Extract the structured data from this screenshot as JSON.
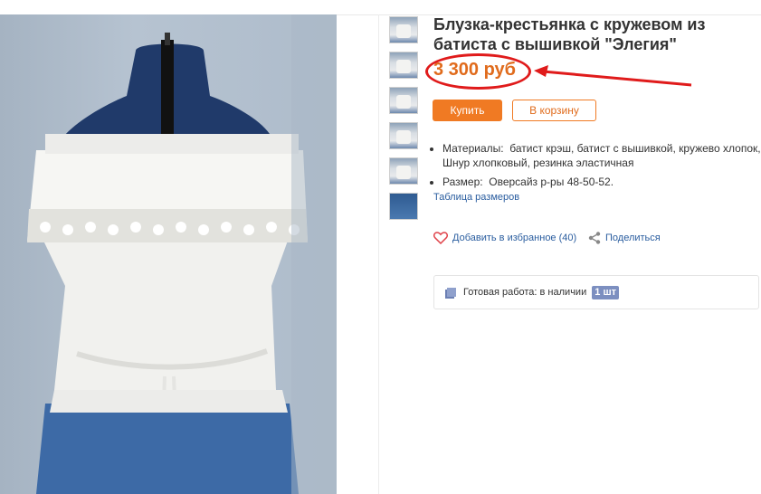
{
  "product": {
    "title": "Блузка-крестьянка с кружевом из батиста с вышивкой \"Элегия\"",
    "price": "3 300 руб",
    "buy_label": "Купить",
    "cart_label": "В корзину",
    "properties": [
      {
        "label": "Материалы:",
        "value": "батист крэш, батист с вышивкой, кружево хлопок, Шнур хлопковый, резинка эластичная"
      },
      {
        "label": "Размер:",
        "value": "Оверсайз р-ры 48-50-52."
      }
    ],
    "size_table_link": "Таблица размеров",
    "favorite_label": "Добавить в избранное (40)",
    "share_label": "Поделиться",
    "availability_text": "Готовая работа: в наличии",
    "availability_count": "1 шт"
  },
  "colors": {
    "accent": "#f07a23",
    "price": "#e06b1c",
    "annotation": "#e01b1b",
    "link": "#2a5d9f"
  },
  "icons": [
    "heart-icon",
    "share-icon",
    "box-icon"
  ]
}
